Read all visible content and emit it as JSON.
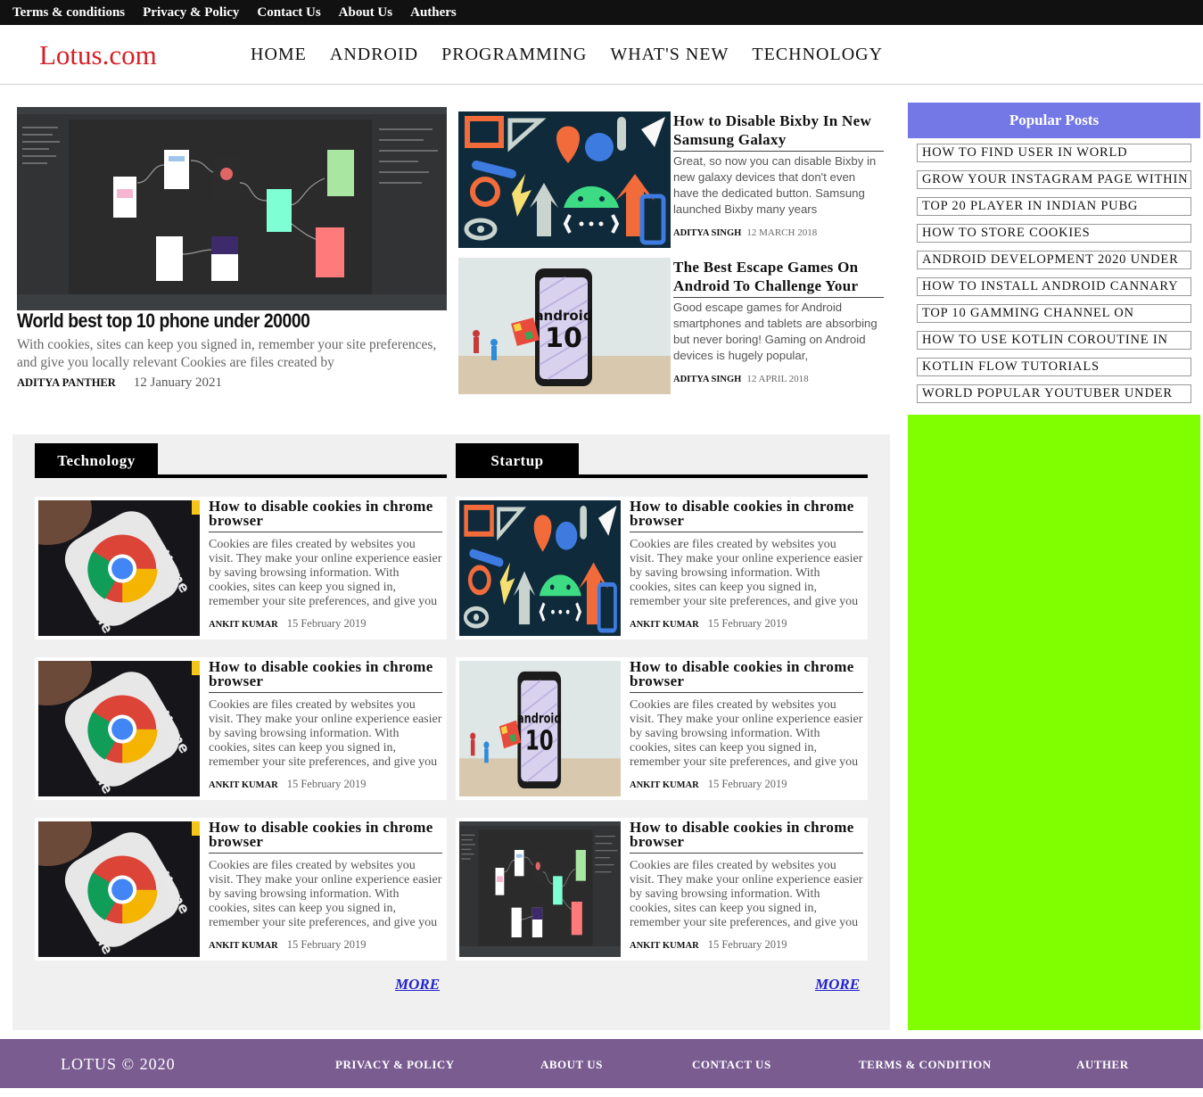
{
  "topbar": {
    "links": [
      "Terms & conditions",
      "Privacy & Policy",
      "Contact Us",
      "About Us",
      "Authers"
    ]
  },
  "header": {
    "logo": "Lotus.com",
    "nav": [
      "HOME",
      "ANDROID",
      "PROGRAMMING",
      "WHAT'S NEW",
      "TECHNOLOGY"
    ]
  },
  "hero": {
    "image": "android-studio-screenshot",
    "title": "World best top 10 phone under 20000",
    "desc": "With cookies, sites can keep you signed in, remember your site preferences, and give you locally relevant Cookies are files created by",
    "author": "ADITYA PANTHER",
    "date": "12 January 2021"
  },
  "side_posts": [
    {
      "image": "android-icons-art",
      "title": "How to Disable Bixby In New Samsung Galaxy",
      "desc": "Great, so now you can disable Bixby in new galaxy devices that don't even have the dedicated button. Samsung launched Bixby many years",
      "author": "ADITYA SINGH",
      "date": "12 MARCH 2018"
    },
    {
      "image": "android-10-phone",
      "title": "The Best Escape Games On Android To Challenge Your",
      "desc": "Good escape games for Android smartphones and tablets are absorbing but never boring! Gaming on Android devices is hugely popular,",
      "author": "ADITYA SINGH",
      "date": "12 APRIL 2018"
    }
  ],
  "popular": {
    "heading": "Popular Posts",
    "items": [
      "HOW TO FIND USER IN WORLD",
      "GROW YOUR INSTAGRAM PAGE WITHIN",
      "TOP 20 PLAYER IN INDIAN PUBG",
      "HOW TO STORE COOKIES",
      "ANDROID DEVELOPMENT 2020 UNDER",
      "HOW TO INSTALL ANDROID CANNARY",
      "TOP 10 GAMMING CHANNEL ON",
      "HOW TO USE KOTLIN COROUTINE IN",
      "KOTLIN FLOW TUTORIALS",
      "WORLD POPULAR YOUTUBER UNDER"
    ]
  },
  "sections": [
    {
      "heading": "Technology",
      "more": "MORE",
      "cards": [
        {
          "image": "chrome-icon-photo",
          "title": "How to disable cookies in chrome browser",
          "desc": "Cookies are files created by websites you visit. They make your online experience easier by saving browsing information. With cookies, sites can keep you signed in, remember your site preferences, and give you locally relevant",
          "author": "ANKIT KUMAR",
          "date": "15 February 2019"
        },
        {
          "image": "chrome-icon-photo",
          "title": "How to disable cookies in chrome browser",
          "desc": "Cookies are files created by websites you visit. They make your online experience easier by saving browsing information. With cookies, sites can keep you signed in, remember your site preferences, and give you locally relevant",
          "author": "ANKIT KUMAR",
          "date": "15 February 2019"
        },
        {
          "image": "chrome-icon-photo",
          "title": "How to disable cookies in chrome browser",
          "desc": "Cookies are files created by websites you visit. They make your online experience easier by saving browsing information. With cookies, sites can keep you signed in, remember your site preferences, and give you locally relevant",
          "author": "ANKIT KUMAR",
          "date": "15 February 2019"
        }
      ]
    },
    {
      "heading": "Startup",
      "more": "MORE",
      "cards": [
        {
          "image": "android-icons-art",
          "title": "How to disable cookies in chrome browser",
          "desc": "Cookies are files created by websites you visit. They make your online experience easier by saving browsing information. With cookies, sites can keep you signed in, remember your site preferences, and give you locally relevant",
          "author": "ANKIT KUMAR",
          "date": "15 February 2019"
        },
        {
          "image": "android-10-phone",
          "title": "How to disable cookies in chrome browser",
          "desc": "Cookies are files created by websites you visit. They make your online experience easier by saving browsing information. With cookies, sites can keep you signed in, remember your site preferences, and give you locally relevant",
          "author": "ANKIT KUMAR",
          "date": "15 February 2019"
        },
        {
          "image": "android-studio-screenshot",
          "title": "How to disable cookies in chrome browser",
          "desc": "Cookies are files created by websites you visit. They make your online experience easier by saving browsing information. With cookies, sites can keep you signed in, remember your site preferences, and give you locally relevant",
          "author": "ANKIT KUMAR",
          "date": "15 February 2019"
        }
      ]
    }
  ],
  "footer": {
    "copyright": "LOTUS © 2020",
    "links": [
      "PRIVACY & POLICY",
      "ABOUT US",
      "CONTACT US",
      "TERMS & CONDITION",
      "AUTHER"
    ]
  },
  "colors": {
    "topbar": "#111111",
    "logo": "#d61f26",
    "popular_header": "#7378e6",
    "sidebar_bg": "#80ff00",
    "footer": "#7a5c91",
    "more_link": "#2222cc"
  }
}
